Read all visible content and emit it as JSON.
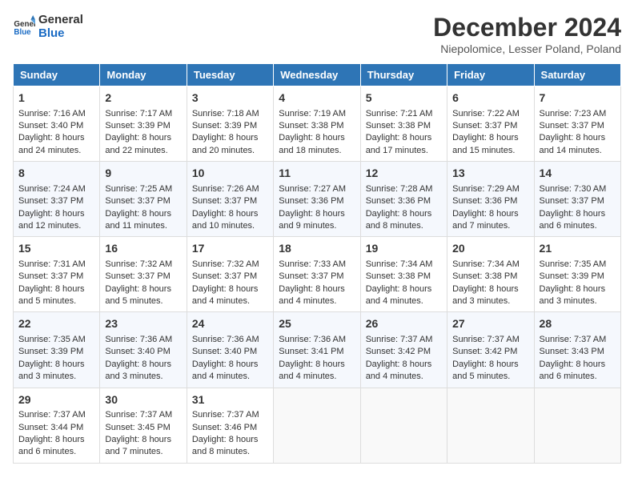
{
  "logo": {
    "line1": "General",
    "line2": "Blue"
  },
  "title": "December 2024",
  "subtitle": "Niepolomice, Lesser Poland, Poland",
  "headers": [
    "Sunday",
    "Monday",
    "Tuesday",
    "Wednesday",
    "Thursday",
    "Friday",
    "Saturday"
  ],
  "weeks": [
    [
      {
        "day": "1",
        "lines": [
          "Sunrise: 7:16 AM",
          "Sunset: 3:40 PM",
          "Daylight: 8 hours",
          "and 24 minutes."
        ]
      },
      {
        "day": "2",
        "lines": [
          "Sunrise: 7:17 AM",
          "Sunset: 3:39 PM",
          "Daylight: 8 hours",
          "and 22 minutes."
        ]
      },
      {
        "day": "3",
        "lines": [
          "Sunrise: 7:18 AM",
          "Sunset: 3:39 PM",
          "Daylight: 8 hours",
          "and 20 minutes."
        ]
      },
      {
        "day": "4",
        "lines": [
          "Sunrise: 7:19 AM",
          "Sunset: 3:38 PM",
          "Daylight: 8 hours",
          "and 18 minutes."
        ]
      },
      {
        "day": "5",
        "lines": [
          "Sunrise: 7:21 AM",
          "Sunset: 3:38 PM",
          "Daylight: 8 hours",
          "and 17 minutes."
        ]
      },
      {
        "day": "6",
        "lines": [
          "Sunrise: 7:22 AM",
          "Sunset: 3:37 PM",
          "Daylight: 8 hours",
          "and 15 minutes."
        ]
      },
      {
        "day": "7",
        "lines": [
          "Sunrise: 7:23 AM",
          "Sunset: 3:37 PM",
          "Daylight: 8 hours",
          "and 14 minutes."
        ]
      }
    ],
    [
      {
        "day": "8",
        "lines": [
          "Sunrise: 7:24 AM",
          "Sunset: 3:37 PM",
          "Daylight: 8 hours",
          "and 12 minutes."
        ]
      },
      {
        "day": "9",
        "lines": [
          "Sunrise: 7:25 AM",
          "Sunset: 3:37 PM",
          "Daylight: 8 hours",
          "and 11 minutes."
        ]
      },
      {
        "day": "10",
        "lines": [
          "Sunrise: 7:26 AM",
          "Sunset: 3:37 PM",
          "Daylight: 8 hours",
          "and 10 minutes."
        ]
      },
      {
        "day": "11",
        "lines": [
          "Sunrise: 7:27 AM",
          "Sunset: 3:36 PM",
          "Daylight: 8 hours",
          "and 9 minutes."
        ]
      },
      {
        "day": "12",
        "lines": [
          "Sunrise: 7:28 AM",
          "Sunset: 3:36 PM",
          "Daylight: 8 hours",
          "and 8 minutes."
        ]
      },
      {
        "day": "13",
        "lines": [
          "Sunrise: 7:29 AM",
          "Sunset: 3:36 PM",
          "Daylight: 8 hours",
          "and 7 minutes."
        ]
      },
      {
        "day": "14",
        "lines": [
          "Sunrise: 7:30 AM",
          "Sunset: 3:37 PM",
          "Daylight: 8 hours",
          "and 6 minutes."
        ]
      }
    ],
    [
      {
        "day": "15",
        "lines": [
          "Sunrise: 7:31 AM",
          "Sunset: 3:37 PM",
          "Daylight: 8 hours",
          "and 5 minutes."
        ]
      },
      {
        "day": "16",
        "lines": [
          "Sunrise: 7:32 AM",
          "Sunset: 3:37 PM",
          "Daylight: 8 hours",
          "and 5 minutes."
        ]
      },
      {
        "day": "17",
        "lines": [
          "Sunrise: 7:32 AM",
          "Sunset: 3:37 PM",
          "Daylight: 8 hours",
          "and 4 minutes."
        ]
      },
      {
        "day": "18",
        "lines": [
          "Sunrise: 7:33 AM",
          "Sunset: 3:37 PM",
          "Daylight: 8 hours",
          "and 4 minutes."
        ]
      },
      {
        "day": "19",
        "lines": [
          "Sunrise: 7:34 AM",
          "Sunset: 3:38 PM",
          "Daylight: 8 hours",
          "and 4 minutes."
        ]
      },
      {
        "day": "20",
        "lines": [
          "Sunrise: 7:34 AM",
          "Sunset: 3:38 PM",
          "Daylight: 8 hours",
          "and 3 minutes."
        ]
      },
      {
        "day": "21",
        "lines": [
          "Sunrise: 7:35 AM",
          "Sunset: 3:39 PM",
          "Daylight: 8 hours",
          "and 3 minutes."
        ]
      }
    ],
    [
      {
        "day": "22",
        "lines": [
          "Sunrise: 7:35 AM",
          "Sunset: 3:39 PM",
          "Daylight: 8 hours",
          "and 3 minutes."
        ]
      },
      {
        "day": "23",
        "lines": [
          "Sunrise: 7:36 AM",
          "Sunset: 3:40 PM",
          "Daylight: 8 hours",
          "and 3 minutes."
        ]
      },
      {
        "day": "24",
        "lines": [
          "Sunrise: 7:36 AM",
          "Sunset: 3:40 PM",
          "Daylight: 8 hours",
          "and 4 minutes."
        ]
      },
      {
        "day": "25",
        "lines": [
          "Sunrise: 7:36 AM",
          "Sunset: 3:41 PM",
          "Daylight: 8 hours",
          "and 4 minutes."
        ]
      },
      {
        "day": "26",
        "lines": [
          "Sunrise: 7:37 AM",
          "Sunset: 3:42 PM",
          "Daylight: 8 hours",
          "and 4 minutes."
        ]
      },
      {
        "day": "27",
        "lines": [
          "Sunrise: 7:37 AM",
          "Sunset: 3:42 PM",
          "Daylight: 8 hours",
          "and 5 minutes."
        ]
      },
      {
        "day": "28",
        "lines": [
          "Sunrise: 7:37 AM",
          "Sunset: 3:43 PM",
          "Daylight: 8 hours",
          "and 6 minutes."
        ]
      }
    ],
    [
      {
        "day": "29",
        "lines": [
          "Sunrise: 7:37 AM",
          "Sunset: 3:44 PM",
          "Daylight: 8 hours",
          "and 6 minutes."
        ]
      },
      {
        "day": "30",
        "lines": [
          "Sunrise: 7:37 AM",
          "Sunset: 3:45 PM",
          "Daylight: 8 hours",
          "and 7 minutes."
        ]
      },
      {
        "day": "31",
        "lines": [
          "Sunrise: 7:37 AM",
          "Sunset: 3:46 PM",
          "Daylight: 8 hours",
          "and 8 minutes."
        ]
      },
      null,
      null,
      null,
      null
    ]
  ]
}
